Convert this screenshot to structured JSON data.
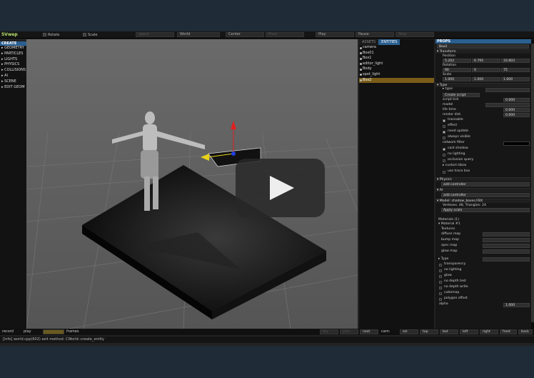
{
  "topbar": {
    "logo": "5Vwep",
    "rotate": "Rotate",
    "scale": "Scale",
    "space_field": "space",
    "world": "World",
    "center": "Center",
    "pivot": "Pivot",
    "play": "Play",
    "pause": "Pause",
    "stop": "Stop"
  },
  "left_panel": {
    "header": "CREATE",
    "items": [
      "▸ GEOMETRY",
      "▸ PARTICLES",
      "▸ LIGHTS",
      "▸ PHYSICS",
      "▸ COLLISIONS",
      "▸ AI",
      "▸ SCENE",
      "▸ EDIT GEOM"
    ]
  },
  "assets": {
    "tab_assets": "ASSETS",
    "tab_entities": "ENTITIES",
    "entities": [
      "camera",
      "Box01",
      "Box1",
      "editor_light",
      "Body",
      "spot_light",
      "Box2"
    ],
    "selected_index": 6
  },
  "props": {
    "header": "PROPS",
    "entity_name": "Box2",
    "transform": "▾ Transform",
    "position_label": "Position",
    "position": [
      "5.202",
      "6.795",
      "33.803"
    ],
    "rotation_label": "Rotation",
    "rotation": [
      "90",
      "0",
      "75"
    ],
    "scale_label": "Scale",
    "scale": [
      "1.000",
      "1.000",
      "1.000"
    ],
    "type_section": "▾ Type",
    "type_label": "▸ type",
    "create_script": "Create script",
    "script_tick": "script tick",
    "script_tick_val": "0.000",
    "model": "model",
    "life_time": "life time",
    "life_time_val": "0.000",
    "render_dist": "render dist.",
    "render_dist_val": "0.000",
    "traceable": "traceable",
    "effect": "effect",
    "need_update": "need update",
    "always_visible": "always visible",
    "network_filter": "network filter",
    "cast_shadow": "cast shadow",
    "no_lighting": "no lighting",
    "occlusion_query": "occlusion query",
    "custom_bbox": "▸ custom bbox",
    "use_trace_box": "use trace box",
    "physics": "▾ Physics",
    "add_controller": "add controller",
    "ai": "▾ AI",
    "add_controller2": "add controller",
    "model_section": "▾ Model: shadow_boxes.FBX",
    "vertexes": "Vertexes: 48, Triangles: 24",
    "apply_scale": "Apply scale",
    "materials": "Materials (1)",
    "material1": "▾ Material #1",
    "textures": "Textures",
    "diffuse_map": "diffuse map",
    "bump_map": "bump map",
    "spec_map": "spec map",
    "glow_map": "glow map",
    "type2": "▸ Type",
    "transparency": "transparency",
    "no_lighting2": "no lighting",
    "glow": "glow",
    "no_depth_test": "no depth test",
    "no_depth_write": "no depth write",
    "cubemap": "cubemap",
    "polygon_offset": "polygon offset",
    "alpha": "alpha",
    "alpha_val": "1.000"
  },
  "bottombar": {
    "record": "record",
    "play": "play",
    "frames": "frames",
    "buttons": [
      "key",
      "prev",
      "next",
      "cam:",
      "sel",
      "top",
      "bot",
      "left",
      "right",
      "front",
      "back"
    ]
  },
  "status": "[Info] world.cpp(602) exit method: CWorld::create_entity",
  "colors": {
    "accent": "#2a5f90",
    "selection": "#7a5d1a",
    "gizmo_red": "#e02020",
    "gizmo_yellow": "#e8d21a",
    "gizmo_blue": "#2040e0"
  }
}
